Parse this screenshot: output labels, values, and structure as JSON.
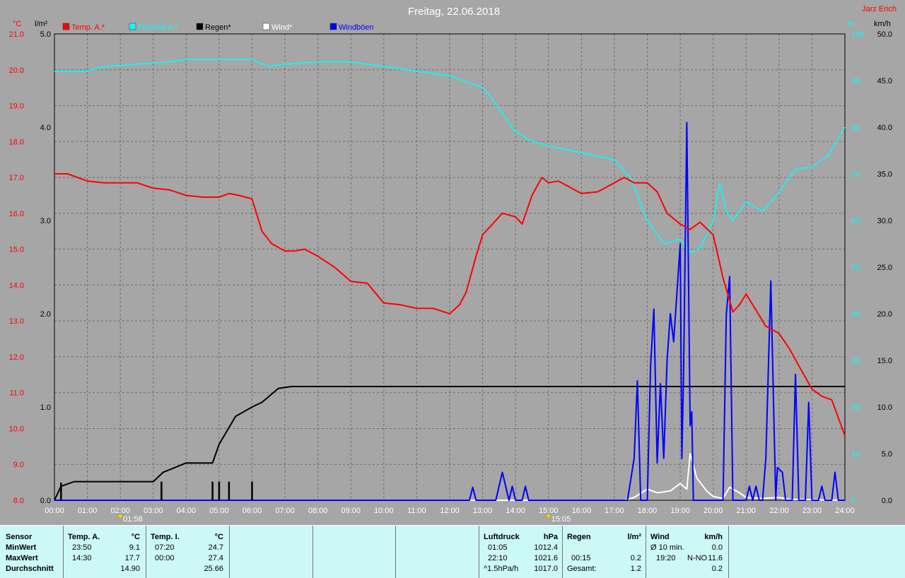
{
  "title": "Freitag, 22.06.2018",
  "author": "Jarz Erich",
  "colors": {
    "temp": "#ff0000",
    "humidity": "#00ffff",
    "rain": "#000000",
    "wind": "#ffffff",
    "gust": "#0000ff",
    "plot_bg": "#a6a6a6",
    "grid": "#6e6e6e",
    "stats_bg": "#ccf8f6"
  },
  "chart_data": {
    "type": "line",
    "title": "Freitag, 22.06.2018",
    "x_unit": "hours",
    "xlim": [
      0,
      24
    ],
    "x_ticks": [
      "00:00",
      "01:00",
      "02:00",
      "03:00",
      "04:00",
      "05:00",
      "06:00",
      "07:00",
      "08:00",
      "09:00",
      "10:00",
      "11:00",
      "12:00",
      "13:00",
      "14:00",
      "15:00",
      "16:00",
      "17:00",
      "18:00",
      "19:00",
      "20:00",
      "21:00",
      "22:00",
      "23:00",
      "24:00"
    ],
    "axes": {
      "temp": {
        "unit": "°C",
        "range": [
          8.0,
          21.0
        ],
        "ticks": [
          "8.0",
          "9.0",
          "10.0",
          "11.0",
          "12.0",
          "13.0",
          "14.0",
          "15.0",
          "16.0",
          "17.0",
          "18.0",
          "19.0",
          "20.0",
          "21.0"
        ]
      },
      "rain": {
        "unit": "l/m²",
        "range": [
          0,
          5.0
        ],
        "ticks": [
          "0.0",
          "1.0",
          "2.0",
          "3.0",
          "4.0",
          "5.0"
        ]
      },
      "humidity": {
        "unit": "%",
        "range": [
          0,
          100
        ],
        "ticks": [
          "0",
          "10",
          "20",
          "30",
          "40",
          "50",
          "60",
          "70",
          "80",
          "90",
          "100"
        ]
      },
      "wind": {
        "unit": "km/h",
        "range": [
          0,
          50
        ],
        "ticks": [
          "0.0",
          "5.0",
          "10.0",
          "15.0",
          "20.0",
          "25.0",
          "30.0",
          "35.0",
          "40.0",
          "45.0",
          "50.0"
        ]
      }
    },
    "legend": [
      "Temp. A.*",
      "Feuchte A.*",
      "Regen*",
      "Wind*",
      "Windböen"
    ],
    "markers": [
      {
        "x": 2.0,
        "label": "01:58"
      },
      {
        "x": 15.0,
        "label": "15:05"
      }
    ],
    "series": [
      {
        "name": "Temp. A.*",
        "axis": "temp",
        "points": [
          [
            0,
            17.1
          ],
          [
            0.4,
            17.1
          ],
          [
            1,
            16.9
          ],
          [
            1.5,
            16.85
          ],
          [
            2.5,
            16.85
          ],
          [
            3,
            16.7
          ],
          [
            3.5,
            16.65
          ],
          [
            4,
            16.5
          ],
          [
            4.5,
            16.45
          ],
          [
            5,
            16.45
          ],
          [
            5.3,
            16.55
          ],
          [
            5.6,
            16.5
          ],
          [
            6,
            16.4
          ],
          [
            6.3,
            15.5
          ],
          [
            6.6,
            15.15
          ],
          [
            7,
            14.95
          ],
          [
            7.3,
            14.95
          ],
          [
            7.6,
            15.0
          ],
          [
            8,
            14.8
          ],
          [
            8.5,
            14.5
          ],
          [
            9,
            14.1
          ],
          [
            9.5,
            14.05
          ],
          [
            10,
            13.5
          ],
          [
            10.5,
            13.45
          ],
          [
            11,
            13.35
          ],
          [
            11.5,
            13.35
          ],
          [
            12,
            13.2
          ],
          [
            12.3,
            13.45
          ],
          [
            12.5,
            13.8
          ],
          [
            12.8,
            14.8
          ],
          [
            13,
            15.4
          ],
          [
            13.3,
            15.7
          ],
          [
            13.6,
            16.0
          ],
          [
            14,
            15.9
          ],
          [
            14.2,
            15.7
          ],
          [
            14.5,
            16.5
          ],
          [
            14.8,
            17.0
          ],
          [
            15,
            16.85
          ],
          [
            15.3,
            16.9
          ],
          [
            15.6,
            16.75
          ],
          [
            16,
            16.55
          ],
          [
            16.5,
            16.6
          ],
          [
            17,
            16.85
          ],
          [
            17.3,
            17.0
          ],
          [
            17.6,
            16.85
          ],
          [
            18,
            16.85
          ],
          [
            18.3,
            16.6
          ],
          [
            18.6,
            16.0
          ],
          [
            19,
            15.7
          ],
          [
            19.3,
            15.55
          ],
          [
            19.6,
            15.75
          ],
          [
            20,
            15.4
          ],
          [
            20.3,
            14.2
          ],
          [
            20.6,
            13.25
          ],
          [
            20.8,
            13.45
          ],
          [
            21,
            13.75
          ],
          [
            21.3,
            13.3
          ],
          [
            21.6,
            12.85
          ],
          [
            22,
            12.65
          ],
          [
            22.3,
            12.25
          ],
          [
            22.6,
            11.75
          ],
          [
            23,
            11.1
          ],
          [
            23.3,
            10.9
          ],
          [
            23.6,
            10.8
          ],
          [
            24,
            9.8
          ]
        ]
      },
      {
        "name": "Feuchte A.*",
        "axis": "humidity",
        "points": [
          [
            0,
            92
          ],
          [
            1,
            92
          ],
          [
            1.5,
            93
          ],
          [
            2.5,
            93.5
          ],
          [
            3.5,
            94
          ],
          [
            4,
            94.5
          ],
          [
            5,
            94.5
          ],
          [
            6,
            94.5
          ],
          [
            6.5,
            93
          ],
          [
            7,
            93.5
          ],
          [
            8,
            94
          ],
          [
            9,
            94
          ],
          [
            10,
            93
          ],
          [
            11,
            92
          ],
          [
            12,
            91
          ],
          [
            13,
            88.5
          ],
          [
            13.3,
            86
          ],
          [
            14,
            79
          ],
          [
            14.5,
            77
          ],
          [
            15,
            76
          ],
          [
            16,
            74.5
          ],
          [
            17,
            73
          ],
          [
            17.5,
            69
          ],
          [
            18,
            60
          ],
          [
            18.5,
            55
          ],
          [
            19,
            56
          ],
          [
            19.3,
            53
          ],
          [
            19.6,
            54
          ],
          [
            20,
            60
          ],
          [
            20.2,
            68
          ],
          [
            20.4,
            62
          ],
          [
            20.6,
            60
          ],
          [
            21,
            64
          ],
          [
            21.5,
            62
          ],
          [
            22,
            66
          ],
          [
            22.5,
            71
          ],
          [
            23,
            71.5
          ],
          [
            23.5,
            74
          ],
          [
            24,
            80
          ]
        ]
      },
      {
        "name": "Regen*",
        "axis": "rain",
        "points": [
          [
            0,
            0
          ],
          [
            0.2,
            0.15
          ],
          [
            0.6,
            0.2
          ],
          [
            1.5,
            0.2
          ],
          [
            3,
            0.2
          ],
          [
            3.3,
            0.3
          ],
          [
            4,
            0.4
          ],
          [
            4.8,
            0.4
          ],
          [
            5,
            0.6
          ],
          [
            5.5,
            0.9
          ],
          [
            6,
            1.0
          ],
          [
            6.3,
            1.05
          ],
          [
            6.8,
            1.2
          ],
          [
            7.2,
            1.22
          ],
          [
            24,
            1.22
          ]
        ]
      },
      {
        "name": "Regen-Balken",
        "axis": "rain",
        "points": [
          [
            0.2,
            0.19
          ],
          [
            3.25,
            0.2
          ],
          [
            4.8,
            0.2
          ],
          [
            5.0,
            0.2
          ],
          [
            5.3,
            0.2
          ],
          [
            6.0,
            0.2
          ]
        ]
      },
      {
        "name": "Wind*",
        "axis": "wind",
        "points": [
          [
            0,
            0
          ],
          [
            17.3,
            0
          ],
          [
            17.6,
            0.3
          ],
          [
            18,
            1.2
          ],
          [
            18.3,
            0.8
          ],
          [
            18.7,
            1.0
          ],
          [
            19,
            1.8
          ],
          [
            19.2,
            1.2
          ],
          [
            19.3,
            5.0
          ],
          [
            19.5,
            2.4
          ],
          [
            19.8,
            1.0
          ],
          [
            20,
            0.4
          ],
          [
            20.3,
            0.2
          ],
          [
            20.5,
            1.4
          ],
          [
            20.8,
            0.8
          ],
          [
            21,
            0.3
          ],
          [
            21.5,
            0.2
          ],
          [
            22,
            0.3
          ],
          [
            22.3,
            0.1
          ],
          [
            24,
            0
          ]
        ]
      },
      {
        "name": "Windböen",
        "axis": "wind",
        "points": [
          [
            0,
            0
          ],
          [
            12.6,
            0
          ],
          [
            12.7,
            1.4
          ],
          [
            12.8,
            0
          ],
          [
            13.4,
            0
          ],
          [
            13.6,
            3.0
          ],
          [
            13.8,
            0
          ],
          [
            13.9,
            1.5
          ],
          [
            14.0,
            0
          ],
          [
            14.2,
            0
          ],
          [
            14.3,
            1.5
          ],
          [
            14.4,
            0
          ],
          [
            17.4,
            0
          ],
          [
            17.6,
            4.5
          ],
          [
            17.7,
            12.8
          ],
          [
            17.8,
            0
          ],
          [
            18.0,
            0
          ],
          [
            18.1,
            14.5
          ],
          [
            18.2,
            20.5
          ],
          [
            18.3,
            4.0
          ],
          [
            18.4,
            12.5
          ],
          [
            18.5,
            4.5
          ],
          [
            18.6,
            15
          ],
          [
            18.7,
            20
          ],
          [
            18.8,
            17
          ],
          [
            19.0,
            27.5
          ],
          [
            19.05,
            4.5
          ],
          [
            19.1,
            13
          ],
          [
            19.2,
            40.5
          ],
          [
            19.3,
            8
          ],
          [
            19.35,
            9.5
          ],
          [
            19.4,
            0
          ],
          [
            20.3,
            0
          ],
          [
            20.4,
            20
          ],
          [
            20.5,
            24
          ],
          [
            20.6,
            0
          ],
          [
            21.0,
            0
          ],
          [
            21.1,
            1.5
          ],
          [
            21.2,
            0
          ],
          [
            21.3,
            1.5
          ],
          [
            21.4,
            0
          ],
          [
            21.5,
            0
          ],
          [
            21.6,
            4.5
          ],
          [
            21.75,
            23.5
          ],
          [
            21.9,
            0
          ],
          [
            21.95,
            3.5
          ],
          [
            22.1,
            3.0
          ],
          [
            22.2,
            0
          ],
          [
            22.4,
            0
          ],
          [
            22.5,
            13.5
          ],
          [
            22.6,
            0
          ],
          [
            22.8,
            0
          ],
          [
            22.9,
            10.5
          ],
          [
            23.0,
            0
          ],
          [
            23.2,
            0
          ],
          [
            23.3,
            1.5
          ],
          [
            23.4,
            0
          ],
          [
            23.6,
            0
          ],
          [
            23.7,
            3.0
          ],
          [
            23.8,
            0
          ],
          [
            24,
            0
          ]
        ]
      }
    ]
  },
  "stats": {
    "sensor": {
      "header": "Sensor",
      "rows": [
        "MinWert",
        "MaxWert",
        "Durchschnitt"
      ]
    },
    "temp_a": {
      "header": "Temp. A.",
      "unit": "°C",
      "min_time": "23:50",
      "min": "9.1",
      "max_time": "14:30",
      "max": "17.7",
      "avg": "14.90"
    },
    "temp_i": {
      "header": "Temp. I.",
      "unit": "°C",
      "min_time": "07:20",
      "min": "24.7",
      "max_time": "00:00",
      "max": "27.4",
      "avg": "25.66"
    },
    "pressure": {
      "header": "Luftdruck",
      "unit": "hPa",
      "min_time": "01:05",
      "min": "1012.4",
      "max_time": "22:10",
      "max": "1021.6",
      "trend_label": "^1.5hPa/h",
      "trend_value": "1017.0"
    },
    "rain": {
      "header": "Regen",
      "unit": "l/m²",
      "max_time": "00:15",
      "max": "0.2",
      "total_label": "Gesamt:",
      "total": "1.2"
    },
    "wind": {
      "header": "Wind",
      "unit": "km/h",
      "avg_label": "Ø 10 min.",
      "avg": "0.0",
      "max_time": "19:20",
      "max_dir": "N-NO",
      "max": "11.6",
      "mean": "0.2"
    }
  }
}
